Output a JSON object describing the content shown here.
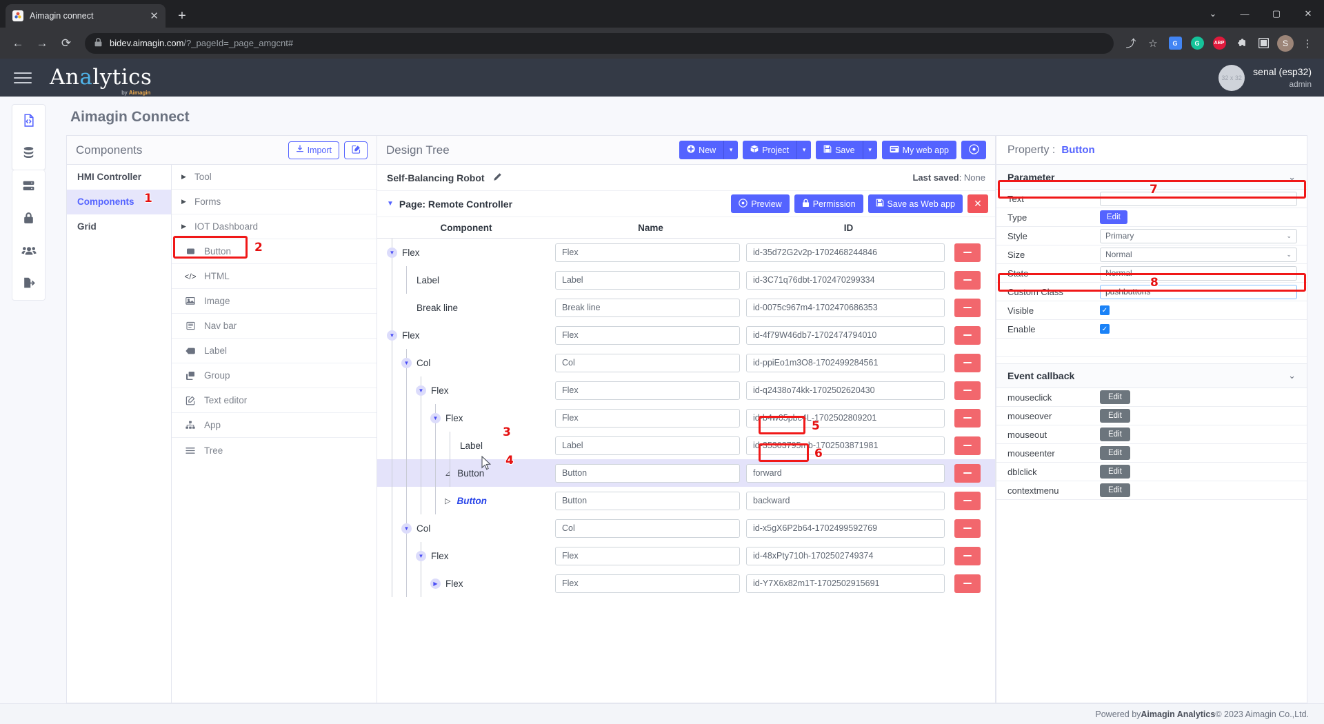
{
  "browser": {
    "tab_title": "Aimagin connect",
    "tab_close": "✕",
    "new_tab": "+",
    "url_host": "bidev.aimagin.com",
    "url_path": "/?_pageId=_page_amgcnt#",
    "minimize": "—",
    "maximize": "▢",
    "close": "✕",
    "chevron": "⌄",
    "back": "←",
    "forward": "→",
    "reload": "⟳",
    "extensions": [
      {
        "name": "translate-extension-icon",
        "label": "G",
        "color": "#4285f4"
      },
      {
        "name": "grammarly-extension-icon",
        "label": "G",
        "color": "#15c39a"
      },
      {
        "name": "adblock-extension-icon",
        "label": "ABP",
        "color": "#e01a3c"
      },
      {
        "name": "puzzle-extension-icon",
        "label": "🧩",
        "color": "transparent"
      },
      {
        "name": "sidepanel-icon",
        "label": "▣",
        "color": "transparent"
      }
    ],
    "profile_initial": "S",
    "menu": "⋮",
    "share": "⤴",
    "bookmark": "☆"
  },
  "app_header": {
    "brand_prefix": "An",
    "brand_highlight": "a",
    "brand_suffix": "lytics",
    "brand_sub_by": "by ",
    "brand_sub_name": "Aimagin",
    "user_avatar_text": "32 x 32",
    "user_name": "senal (esp32)",
    "user_role": "admin"
  },
  "rail": {
    "items": [
      {
        "name": "sidebar-item-code-file",
        "icon": "file-code-icon",
        "active": true
      },
      {
        "name": "sidebar-item-database",
        "icon": "database-icon",
        "active": false
      },
      {
        "name": "sidebar-item-server",
        "icon": "server-icon",
        "active": false
      },
      {
        "name": "sidebar-item-security",
        "icon": "lock-icon",
        "active": false
      },
      {
        "name": "sidebar-item-users",
        "icon": "users-icon",
        "active": false
      },
      {
        "name": "sidebar-item-logout",
        "icon": "logout-icon",
        "active": false
      }
    ]
  },
  "page": {
    "title": "Aimagin Connect"
  },
  "components_panel": {
    "title": "Components",
    "import_label": "Import",
    "import_icon": "download-icon",
    "edit_icon": "pencil-square-icon",
    "categories": [
      {
        "label": "HMI Controller",
        "active": false
      },
      {
        "label": "Components",
        "active": true,
        "badge": "1"
      },
      {
        "label": "Grid",
        "active": false
      }
    ],
    "items": [
      {
        "label": "Tool",
        "icon": "caret-right-icon",
        "type": "group"
      },
      {
        "label": "Forms",
        "icon": "caret-right-icon",
        "type": "group"
      },
      {
        "label": "IOT Dashboard",
        "icon": "caret-right-icon",
        "type": "group"
      },
      {
        "label": "Button",
        "icon": "button-icon",
        "type": "item",
        "highlight": true,
        "badge": "2"
      },
      {
        "label": "HTML",
        "icon": "code-icon",
        "type": "item"
      },
      {
        "label": "Image",
        "icon": "image-icon",
        "type": "item"
      },
      {
        "label": "Nav bar",
        "icon": "navbar-icon",
        "type": "item"
      },
      {
        "label": "Label",
        "icon": "tag-icon",
        "type": "item"
      },
      {
        "label": "Group",
        "icon": "group-icon",
        "type": "item"
      },
      {
        "label": "Text editor",
        "icon": "text-editor-icon",
        "type": "item"
      },
      {
        "label": "App",
        "icon": "sitemap-icon",
        "type": "item"
      },
      {
        "label": "Tree",
        "icon": "list-icon",
        "type": "item"
      }
    ]
  },
  "design_tree": {
    "title": "Design Tree",
    "toolbar": {
      "new_label": "New",
      "new_icon": "plus-circle-icon",
      "project_label": "Project",
      "project_icon": "box-icon",
      "save_label": "Save",
      "save_icon": "floppy-icon",
      "webapp_label": "My web app",
      "webapp_icon": "browser-icon",
      "eye_icon": "eye-icon",
      "split_caret": "▾"
    },
    "project_name": "Self-Balancing Robot",
    "edit_icon": "pencil-icon",
    "last_saved_label": "Last saved",
    "last_saved_value": "None",
    "page_label": "Page: Remote Controller",
    "page_buttons": {
      "preview_label": "Preview",
      "preview_icon": "eye-icon",
      "permission_label": "Permission",
      "permission_icon": "lock-icon",
      "save_web_label": "Save as Web app",
      "save_web_icon": "floppy-icon",
      "close_label": "✕"
    },
    "columns": [
      "Component",
      "Name",
      "ID"
    ],
    "rows": [
      {
        "component": "Flex",
        "depth": 0,
        "twist": "down",
        "name": "Flex",
        "id": "id-35d72G2v2p-1702468244846"
      },
      {
        "component": "Label",
        "depth": 1,
        "twist": "none",
        "name": "Label",
        "id": "id-3C71q76dbt-1702470299334"
      },
      {
        "component": "Break line",
        "depth": 1,
        "twist": "none",
        "name": "Break line",
        "id": "id-0075c967m4-1702470686353"
      },
      {
        "component": "Flex",
        "depth": 0,
        "twist": "down",
        "name": "Flex",
        "id": "id-4f79W46db7-1702474794010"
      },
      {
        "component": "Col",
        "depth": 1,
        "twist": "down",
        "name": "Col",
        "id": "id-ppiEo1m3O8-1702499284561"
      },
      {
        "component": "Flex",
        "depth": 2,
        "twist": "down",
        "name": "Flex",
        "id": "id-q2438o74kk-1702502620430"
      },
      {
        "component": "Flex",
        "depth": 3,
        "twist": "down",
        "name": "Flex",
        "id": "id-b4w05pbc4L-1702502809201"
      },
      {
        "component": "Label",
        "depth": 4,
        "twist": "none",
        "name": "Label",
        "id": "id-35303795mb-1702503871981"
      },
      {
        "component": "Button",
        "depth": 4,
        "twist": "open-mark",
        "name": "Button",
        "id": "forward",
        "selected": true,
        "badge": "3",
        "id_badge": "5",
        "id_narrow": true
      },
      {
        "component": "Button",
        "depth": 4,
        "twist": "right-mark",
        "name": "Button",
        "id": "backward",
        "emphasis": true,
        "badge": "4",
        "id_badge": "6",
        "id_narrow": true
      },
      {
        "component": "Col",
        "depth": 1,
        "twist": "down",
        "name": "Col",
        "id": "id-x5gX6P2b64-1702499592769"
      },
      {
        "component": "Flex",
        "depth": 2,
        "twist": "down",
        "name": "Flex",
        "id": "id-48xPty710h-1702502749374"
      },
      {
        "component": "Flex",
        "depth": 3,
        "twist": "right",
        "name": "Flex",
        "id": "id-Y7X6x82m1T-1702502915691"
      }
    ]
  },
  "property_panel": {
    "head_label": "Property :",
    "head_value": "Button",
    "parameter_section": "Parameter",
    "parameters": [
      {
        "label": "Text",
        "control": "text",
        "value": "",
        "badge": "7",
        "highlight": true
      },
      {
        "label": "Type",
        "control": "button",
        "value": "Edit"
      },
      {
        "label": "Style",
        "control": "select",
        "value": "Primary"
      },
      {
        "label": "Size",
        "control": "select",
        "value": "Normal"
      },
      {
        "label": "State",
        "control": "select",
        "value": "Normal"
      },
      {
        "label": "Custom Class",
        "control": "text",
        "value": "pushbuttons",
        "badge": "8",
        "highlight": true
      },
      {
        "label": "Visible",
        "control": "checkbox",
        "value": "✓"
      },
      {
        "label": "Enable",
        "control": "checkbox",
        "value": "✓"
      }
    ],
    "event_section": "Event callback",
    "events": [
      {
        "label": "mouseclick",
        "button": "Edit"
      },
      {
        "label": "mouseover",
        "button": "Edit"
      },
      {
        "label": "mouseout",
        "button": "Edit"
      },
      {
        "label": "mouseenter",
        "button": "Edit"
      },
      {
        "label": "dblclick",
        "button": "Edit"
      },
      {
        "label": "contextmenu",
        "button": "Edit"
      }
    ],
    "collapse_icon": "chevron-down-icon"
  },
  "footer": {
    "prefix": "Powered by ",
    "brand": "Aimagin Analytics",
    "suffix": " © 2023 Aimagin Co.,Ltd."
  }
}
